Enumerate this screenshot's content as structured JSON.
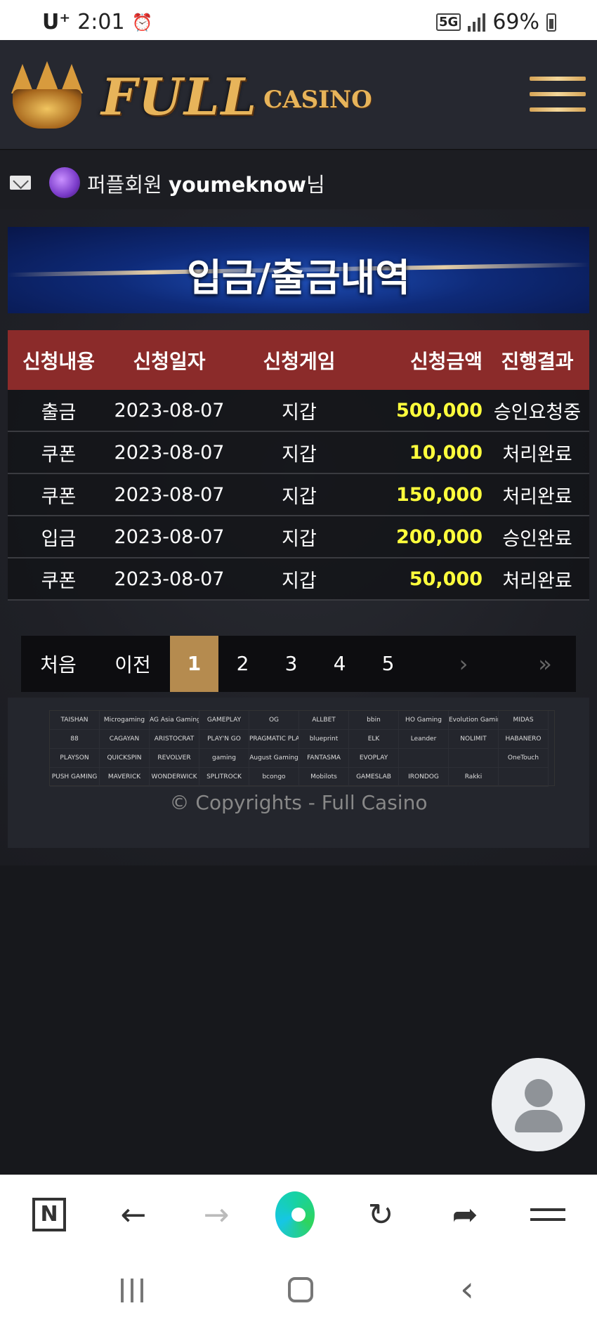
{
  "status_bar": {
    "carrier": "U⁺",
    "time": "2:01",
    "alarm_icon": "alarm-icon",
    "network": "5G",
    "battery": "69%"
  },
  "header": {
    "logo_text": "FULL",
    "logo_subtext": "CASINO",
    "menu_icon": "hamburger-icon"
  },
  "member": {
    "level": "퍼플회원",
    "username": "youmeknow",
    "suffix": "님"
  },
  "banner": {
    "title": "입금/출금내역"
  },
  "table": {
    "headers": [
      "신청내용",
      "신청일자",
      "신청게임",
      "신청금액",
      "진행결과"
    ],
    "rows": [
      [
        "출금",
        "2023-08-07",
        "지갑",
        "500,000",
        "승인요청중"
      ],
      [
        "쿠폰",
        "2023-08-07",
        "지갑",
        "10,000",
        "처리완료"
      ],
      [
        "쿠폰",
        "2023-08-07",
        "지갑",
        "150,000",
        "처리완료"
      ],
      [
        "입금",
        "2023-08-07",
        "지갑",
        "200,000",
        "승인완료"
      ],
      [
        "쿠폰",
        "2023-08-07",
        "지갑",
        "50,000",
        "처리완료"
      ]
    ]
  },
  "pagination": {
    "first": "처음",
    "prev": "이전",
    "pages": [
      "1",
      "2",
      "3",
      "4",
      "5"
    ],
    "active_page": "1",
    "next": "›",
    "last": "»"
  },
  "footer": {
    "providers": [
      "TAISHAN",
      "Microgaming",
      "AG Asia Gaming",
      "GAMEPLAY",
      "OG",
      "ALLBET",
      "bbin",
      "HO Gaming",
      "Evolution Gaming",
      "MIDAS",
      "88",
      "CAGAYAN",
      "ARISTOCRAT",
      "PLAY'N GO",
      "PRAGMATIC PLAY",
      "blueprint",
      "ELK",
      "Leander",
      "NOLIMIT",
      "HABANERO",
      "PLAYSON",
      "QUICKSPIN",
      "REVOLVER",
      "gaming",
      "August Gaming",
      "FANTASMA",
      "EVOPLAY",
      "",
      "",
      "OneTouch",
      "PUSH GAMING",
      "MAVERICK",
      "WONDERWICK",
      "SPLITROCK",
      "bcongo",
      "Mobilots",
      "GAMESLAB",
      "IRONDOG",
      "Rakki",
      ""
    ],
    "copyright": "© Copyrights - Full Casino"
  },
  "browser_bar": {
    "n_label": "N"
  }
}
